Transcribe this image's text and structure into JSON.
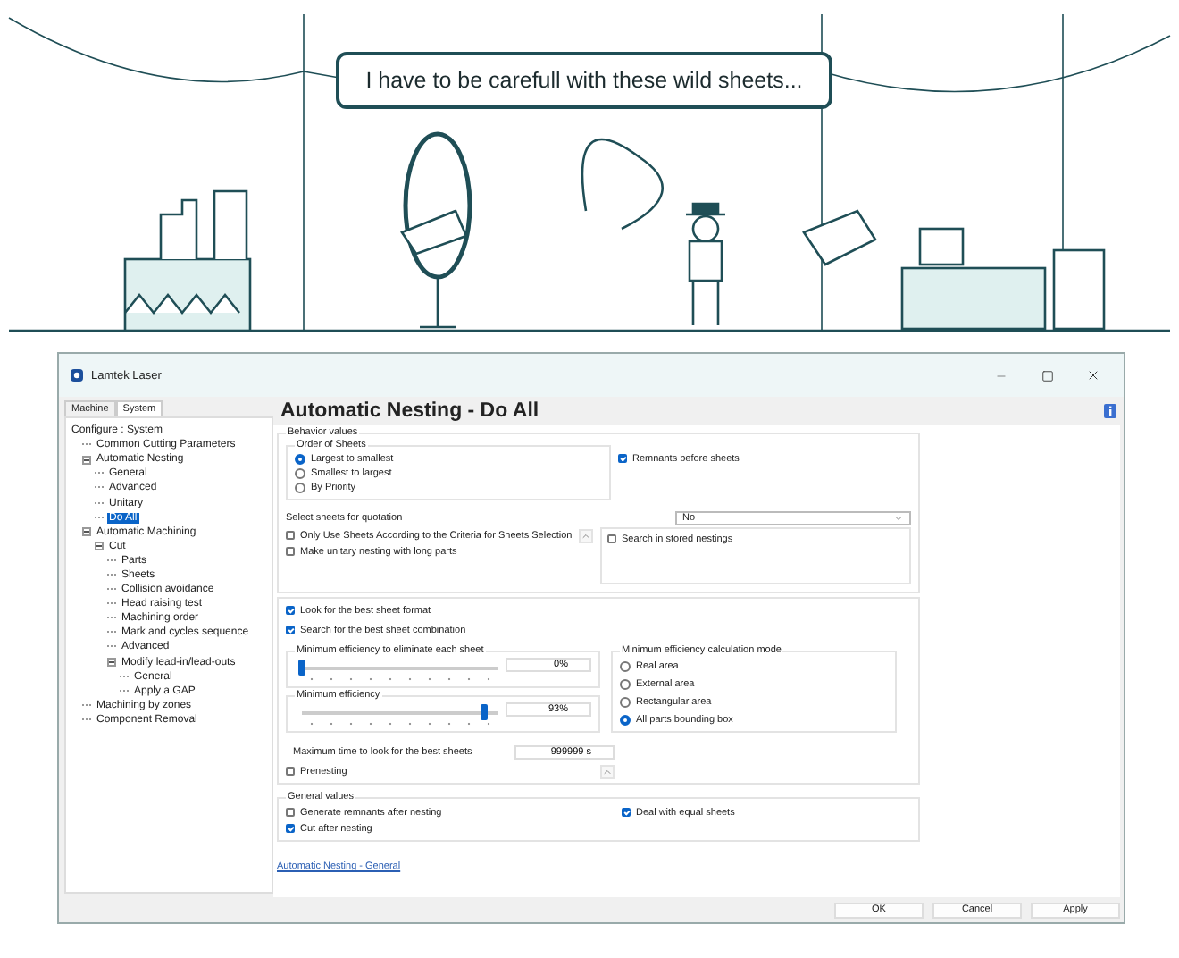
{
  "speech": "I have to be carefull with these wild sheets...",
  "window": {
    "title": "Lamtek Laser"
  },
  "tabs": [
    {
      "label": "Machine",
      "selected": false
    },
    {
      "label": "System",
      "selected": true
    }
  ],
  "tree": {
    "label": "Configure : System",
    "selected": false,
    "children": [
      {
        "label": "Common Cutting Parameters",
        "selected": false
      },
      {
        "label": "Automatic Nesting",
        "selected": false,
        "expanded": true,
        "children": [
          {
            "label": "General",
            "selected": false
          },
          {
            "label": "Advanced",
            "selected": false
          },
          {
            "label": "Unitary",
            "selected": false
          },
          {
            "label": "Do All",
            "selected": true
          }
        ]
      },
      {
        "label": "Automatic Machining",
        "selected": false,
        "expanded": true,
        "children": [
          {
            "label": "Cut",
            "selected": false,
            "expanded": true,
            "children": [
              {
                "label": "Parts",
                "selected": false
              },
              {
                "label": "Sheets",
                "selected": false
              },
              {
                "label": "Collision avoidance",
                "selected": false
              },
              {
                "label": "Head raising test",
                "selected": false
              },
              {
                "label": "Machining order",
                "selected": false
              },
              {
                "label": "Mark and cycles sequence",
                "selected": false
              },
              {
                "label": "Advanced",
                "selected": false
              },
              {
                "label": "Modify lead-in/lead-outs",
                "selected": false,
                "expanded": true,
                "children": [
                  {
                    "label": "General",
                    "selected": false
                  },
                  {
                    "label": "Apply a GAP",
                    "selected": false
                  }
                ]
              }
            ]
          }
        ]
      },
      {
        "label": "Machining by zones",
        "selected": false
      },
      {
        "label": "Component Removal",
        "selected": false
      }
    ]
  },
  "page_title": "Automatic Nesting - Do All",
  "behavior": {
    "title": "Behavior values",
    "order": {
      "title": "Order of Sheets",
      "options": [
        {
          "label": "Largest to smallest",
          "selected": true
        },
        {
          "label": "Smallest to largest",
          "selected": false
        },
        {
          "label": "By Priority",
          "selected": false
        }
      ]
    },
    "remnants_before": {
      "label": "Remnants before sheets",
      "checked": true
    },
    "quotation": {
      "label": "Select sheets for quotation",
      "value": "No"
    },
    "only_use": {
      "label": "Only Use Sheets According to the Criteria for Sheets Selection",
      "checked": false
    },
    "unitary": {
      "label": "Make unitary nesting with long parts",
      "checked": false
    },
    "stored": {
      "label": "Search in stored nestings",
      "checked": false
    }
  },
  "best": {
    "format": {
      "label": "Look for the best sheet format",
      "checked": true
    },
    "combination": {
      "label": "Search for the best sheet combination",
      "checked": true
    },
    "sliders": [
      {
        "title": "Minimum efficiency to eliminate each sheet",
        "level": 0.0,
        "reading": "0%"
      },
      {
        "title": "Minimum efficiency",
        "level": 0.93,
        "reading": "93%"
      }
    ],
    "mode": {
      "title": "Minimum efficiency calculation mode",
      "options": [
        {
          "label": "Real area",
          "selected": false
        },
        {
          "label": "External area",
          "selected": false
        },
        {
          "label": "Rectangular area",
          "selected": false
        },
        {
          "label": "All parts bounding box",
          "selected": true
        }
      ]
    },
    "max_time": {
      "label": "Maximum time to look for the best sheets",
      "value": "999999 s"
    },
    "prenesting": {
      "label": "Prenesting",
      "checked": false
    }
  },
  "general": {
    "title": "General values",
    "left": [
      {
        "label": "Generate remnants after nesting",
        "checked": false
      },
      {
        "label": "Cut after nesting",
        "checked": true
      }
    ],
    "right": [
      {
        "label": "Deal with equal sheets",
        "checked": true
      }
    ]
  },
  "link": "Automatic Nesting - General",
  "buttons": [
    "OK",
    "Cancel",
    "Apply"
  ]
}
